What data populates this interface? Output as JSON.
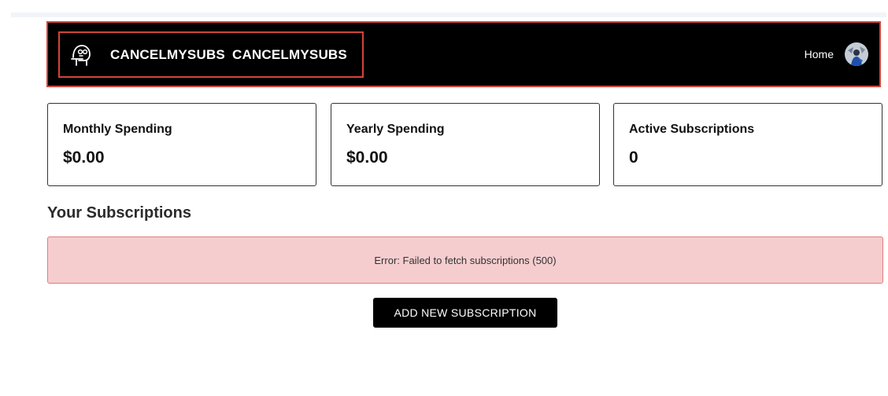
{
  "header": {
    "brand_parts": [
      "CANCELMYSUBS",
      "CANCELMYSUBS"
    ],
    "logo_icon": "ghost-face-icon",
    "nav_home": "Home",
    "avatar_icon": "user-avatar"
  },
  "stats": [
    {
      "label": "Monthly Spending",
      "value": "$0.00"
    },
    {
      "label": "Yearly Spending",
      "value": "$0.00"
    },
    {
      "label": "Active Subscriptions",
      "value": "0"
    }
  ],
  "subscriptions": {
    "title": "Your Subscriptions",
    "error": "Error: Failed to fetch subscriptions (500)",
    "add_button": "ADD NEW SUBSCRIPTION"
  },
  "colors": {
    "navbar_bg": "#000000",
    "highlight_border": "#d1453b",
    "error_bg": "#f6cdcf",
    "error_border": "#e07d7f",
    "button_bg": "#000000"
  }
}
